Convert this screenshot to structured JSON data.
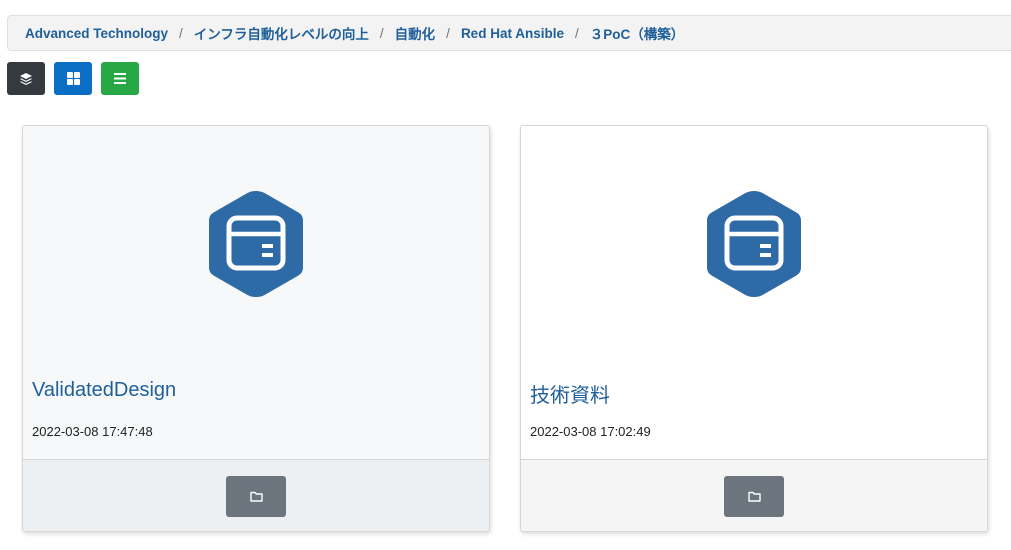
{
  "breadcrumb": {
    "items": [
      "Advanced Technology",
      "インフラ自動化レベルの向上",
      "自動化",
      "Red Hat Ansible",
      "３PoC（構築）"
    ],
    "separator": "/"
  },
  "view_buttons": [
    {
      "name": "layers-view",
      "icon": "layers-icon",
      "color": "#343a40"
    },
    {
      "name": "grid-view",
      "icon": "grid-icon",
      "color": "#0d6efd"
    },
    {
      "name": "list-view",
      "icon": "list-icon",
      "color": "#28a745"
    }
  ],
  "cards": [
    {
      "title": "ValidatedDesign",
      "date": "2022-03-08 17:47:48",
      "icon": "folder-hex-icon",
      "footer_icon": "folder-icon"
    },
    {
      "title": "技術資料",
      "date": "2022-03-08 17:02:49",
      "icon": "folder-hex-icon",
      "footer_icon": "folder-icon"
    }
  ],
  "colors": {
    "accent": "#1f5f99",
    "hex_icon": "#2e6aa5",
    "card_body_hover": "#f6f8f9",
    "card_footer_hover": "#edf0f2",
    "card_footer": "#f5f5f5",
    "open_button": "#6c757d"
  }
}
